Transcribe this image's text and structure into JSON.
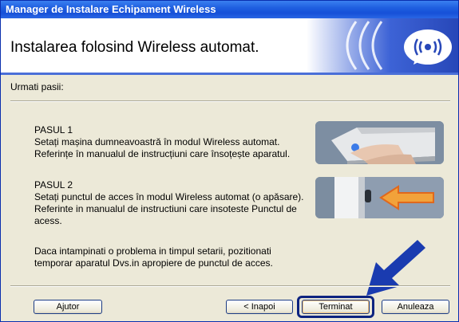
{
  "window": {
    "title": "Manager de Instalare Echipament Wireless"
  },
  "header": {
    "title": "Instalarea folosind Wireless automat."
  },
  "subheading": "Urmati pasii:",
  "steps": [
    {
      "label": "PASUL 1",
      "line1": "Setați mașina dumneavoastră în modul Wireless automat.",
      "line2": "Referințe în manualul de instrucțiuni care însoțește aparatul.",
      "line3": ""
    },
    {
      "label": "PASUL 2",
      "line1": "Setați punctul de acces în modul Wireless automat (o apăsare).",
      "line2": "Referinte in manualul de instructiuni care insoteste Punctul de",
      "line3": "acess."
    }
  ],
  "note": {
    "line1": "Daca intampinati o problema in timpul setarii, pozitionati",
    "line2": "temporar aparatul Dvs.in apropiere de punctul de acces."
  },
  "buttons": {
    "help": "Ajutor",
    "back": "< Inapoi",
    "finish": "Terminat",
    "cancel": "Anuleaza"
  },
  "colors": {
    "titlebar": "#1f5fe0",
    "accent": "#0e2480",
    "arrow": "#1a3bb0",
    "dialog_bg": "#ece9d8"
  },
  "icons": {
    "header": "wireless-signal-icon",
    "step1": "printer-button-press-icon",
    "step2": "access-point-button-icon",
    "pointer": "blue-arrow-icon"
  }
}
